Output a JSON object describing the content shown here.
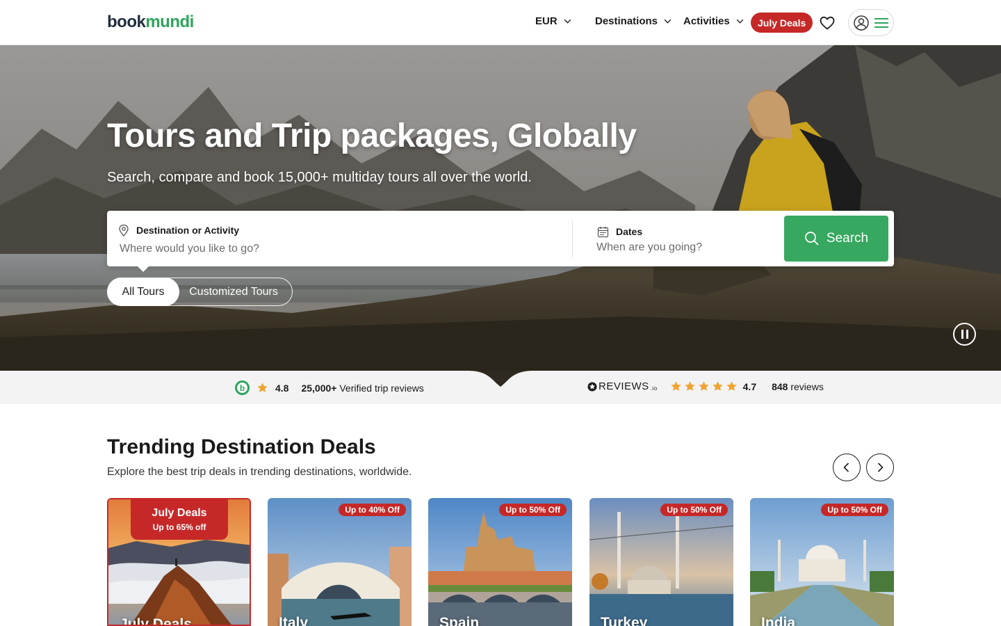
{
  "header": {
    "logo_part1": "book",
    "logo_part2": "mundi",
    "currency": "EUR",
    "nav": [
      "Destinations",
      "Activities"
    ],
    "deals_label": "July Deals",
    "icons": [
      "heart-icon",
      "user-icon",
      "menu-icon"
    ]
  },
  "hero": {
    "title": "Tours and Trip packages, Globally",
    "subtitle": "Search, compare and book 15,000+ multiday tours all over the world."
  },
  "search": {
    "destination_label": "Destination or Activity",
    "destination_placeholder": "Where would you like to go?",
    "dates_label": "Dates",
    "dates_placeholder": "When are you going?",
    "button_label": "Search"
  },
  "tour_toggle": {
    "options": [
      "All Tours",
      "Customized Tours"
    ],
    "selected": "All Tours"
  },
  "reviews": {
    "bookmundi_rating": "4.8",
    "bookmundi_count": "25,000+",
    "bookmundi_text": "Verified trip reviews",
    "reviewsio_logo": "REVIEWS",
    "reviewsio_suffix": ".io",
    "reviewsio_rating": "4.7",
    "reviewsio_count": "848",
    "reviewsio_text": "reviews",
    "star_color": "#f0a330"
  },
  "trending": {
    "title": "Trending Destination Deals",
    "subtitle": "Explore the best trip deals in trending destinations, worldwide.",
    "cards": [
      {
        "name": "July Deals",
        "badge_title": "July Deals",
        "badge_sub": "Up to 65% off"
      },
      {
        "name": "Italy",
        "discount": "Up to 40% Off"
      },
      {
        "name": "Spain",
        "discount": "Up to 50% Off"
      },
      {
        "name": "Turkey",
        "discount": "Up to 50% Off"
      },
      {
        "name": "India",
        "discount": "Up to 50% Off"
      }
    ]
  },
  "colors": {
    "brand_green": "#2ea45c",
    "search_green": "#36a85f",
    "deal_red": "#c62828"
  }
}
